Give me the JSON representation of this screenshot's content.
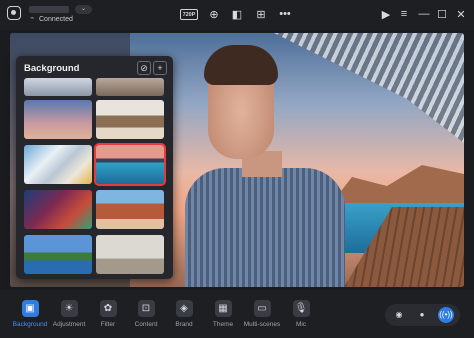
{
  "titlebar": {
    "status": "Connected",
    "resolution": "720P"
  },
  "panel": {
    "title": "Background",
    "add_label": "+"
  },
  "toolbar": {
    "items": [
      {
        "label": "Background",
        "icon": "image-icon",
        "active": true
      },
      {
        "label": "Adjustment",
        "icon": "sun-icon",
        "active": false
      },
      {
        "label": "Filter",
        "icon": "filter-icon",
        "active": false
      },
      {
        "label": "Content",
        "icon": "content-icon",
        "active": false
      },
      {
        "label": "Brand",
        "icon": "brand-tag-icon",
        "active": false
      },
      {
        "label": "Theme",
        "icon": "theme-icon",
        "active": false
      },
      {
        "label": "Multi-scenes",
        "icon": "scenes-icon",
        "active": false
      },
      {
        "label": "Mic",
        "icon": "mic-icon",
        "active": false
      }
    ]
  },
  "colors": {
    "accent": "#2f7de1",
    "selection": "#e53d3d",
    "panel_bg": "#26272c",
    "bar_bg": "#1e1f23"
  }
}
